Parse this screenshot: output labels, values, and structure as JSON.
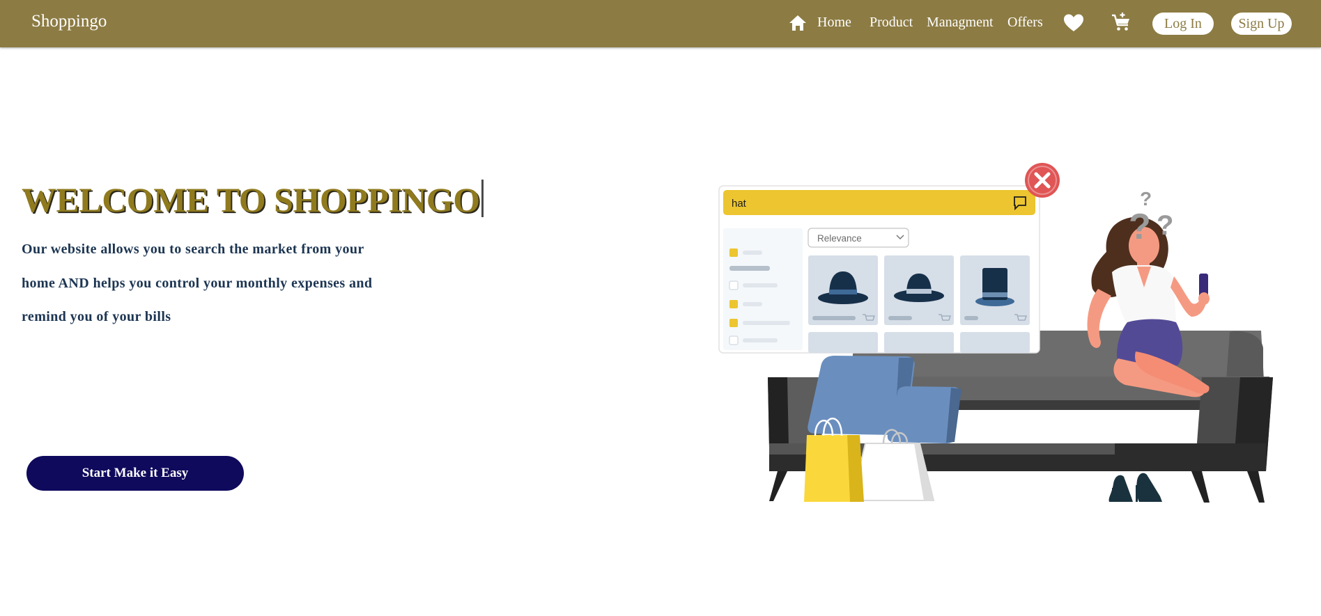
{
  "navbar": {
    "brand": "Shoppingo",
    "links": {
      "home": "Home",
      "product": "Product",
      "management": "Managment",
      "offers": "Offers"
    },
    "login_label": "Log In",
    "signup_label": "Sign Up",
    "icons": [
      "home-icon",
      "heart-icon",
      "cart-icon"
    ]
  },
  "hero": {
    "title": "WELCOME TO SHOPPINGO",
    "description": "Our website allows you to search the market from your home AND helps you control your monthly expenses and remind you of your bills",
    "cta_label": "Start Make it Easy"
  },
  "illustration": {
    "search_query": "hat",
    "sort_select": "Relevance"
  },
  "colors": {
    "navbar_bg": "#8c7b43",
    "title_gold": "#8f7a1e",
    "text_navy": "#1c3552",
    "cta_bg": "#0f0a5c",
    "search_bar_yellow": "#ecc530",
    "close_red": "#e05555"
  }
}
